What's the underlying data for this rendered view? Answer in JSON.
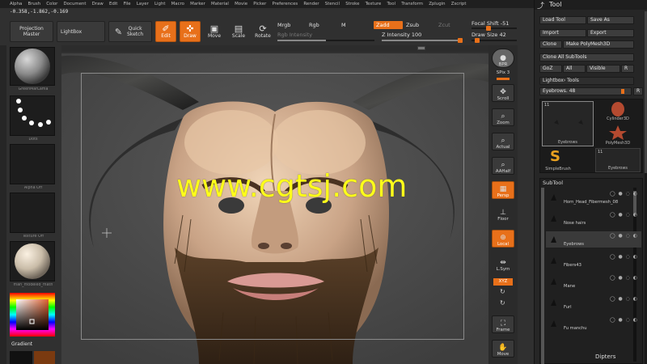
{
  "menu": [
    "Alpha",
    "Brush",
    "Color",
    "Document",
    "Draw",
    "Edit",
    "File",
    "Layer",
    "Light",
    "Macro",
    "Marker",
    "Material",
    "Movie",
    "Picker",
    "Preferences",
    "Render",
    "Stencil",
    "Stroke",
    "Texture",
    "Tool",
    "Transform",
    "Zplugin",
    "Zscript"
  ],
  "coords": "-0.358,-1.862,-0.169",
  "toolbar": {
    "projection_master": "Projection Master",
    "lightbox": "LightBox",
    "quick_sketch": "Quick Sketch",
    "edit": "Edit",
    "draw": "Draw",
    "move": "Move",
    "scale": "Scale",
    "rotate": "Rotate",
    "mrgb": "Mrgb",
    "rgb": "Rgb",
    "m": "M",
    "rgb_intensity": "Rgb Intensity",
    "zadd": "Zadd",
    "zsub": "Zsub",
    "zcut": "Zcut",
    "z_intensity": "Z Intensity 100",
    "focal_shift": "Focal Shift -51",
    "draw_size": "Draw Size 42"
  },
  "left_shelf": {
    "material_top": "GreenMarLama",
    "dots": "Dots",
    "alpha_off": "Alpha Off",
    "texture_off": "Texture Off",
    "material_bottom": "mah_modeled_math",
    "gradient": "Gradient"
  },
  "watermark": "www.cgtsj.com",
  "right_shelf": {
    "bpr": "BPR",
    "spix": "SPix 3",
    "scroll": "Scroll",
    "zoom": "Zoom",
    "actual": "Actual",
    "aahalf": "AAHalf",
    "persp": "Persp",
    "floor": "Floor",
    "local": "Local",
    "lsym": "L.Sym",
    "xyz": "XYZ",
    "frame": "Frame",
    "move": "Move"
  },
  "tool_panel": {
    "title": "Tool",
    "load_tool": "Load Tool",
    "save_as": "Save As",
    "import": "Import",
    "export": "Export",
    "clone": "Clone",
    "make_polymesh": "Make PolyMesh3D",
    "clone_all": "Clone All SubTools",
    "goz": "GoZ",
    "all": "All",
    "visible": "Visible",
    "r": "R",
    "lightbox_tools": "Lightbox› Tools",
    "eyebrows_slider": "Eyebrows. 48",
    "thumbs": {
      "count": "11",
      "eyebrows_a": "Eyebrows",
      "cylinder": "Cylinder3D",
      "polymesh": "PolyMesh3D",
      "simplebrush": "SimpleBrush",
      "count_b": "11",
      "eyebrows_b": "Eyebrows"
    },
    "subtool_title": "SubTool",
    "subtools": [
      "Horn_Head_Fibermesh_08",
      "Nose hairs",
      "Eyebrows",
      "Fibers43",
      "Mane",
      "Furl",
      "Fu manchu"
    ],
    "footer": "Dipters"
  },
  "colors": {
    "accent": "#e8701a",
    "watermark": "#ffff1a"
  }
}
